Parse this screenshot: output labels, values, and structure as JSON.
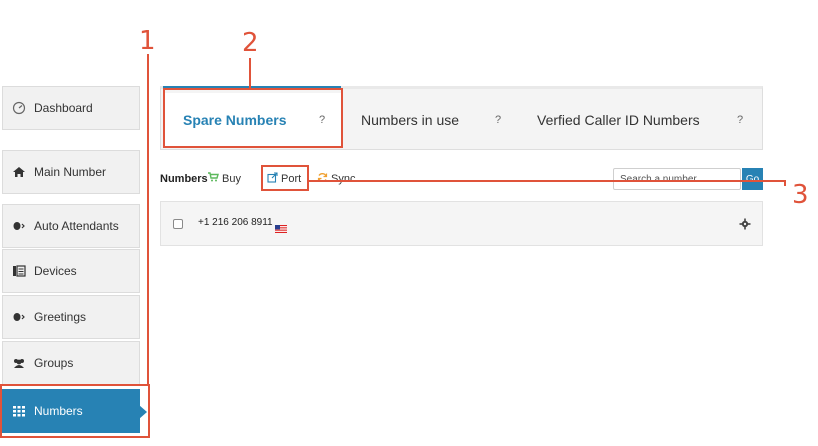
{
  "sidebar": {
    "items": [
      {
        "label": "Dashboard",
        "icon": "gauge-icon"
      },
      {
        "label": "Main Number",
        "icon": "home-icon"
      },
      {
        "label": "Auto Attendants",
        "icon": "speaker-icon"
      },
      {
        "label": "Devices",
        "icon": "devices-icon"
      },
      {
        "label": "Greetings",
        "icon": "speaker-icon"
      },
      {
        "label": "Groups",
        "icon": "users-icon"
      },
      {
        "label": "Numbers",
        "icon": "grid-icon",
        "active": true
      }
    ]
  },
  "tabs": [
    {
      "label": "Spare Numbers",
      "help": "?",
      "active": true
    },
    {
      "label": "Numbers in use",
      "help": "?"
    },
    {
      "label": "Verfied Caller ID Numbers",
      "help": "?"
    }
  ],
  "toolbar": {
    "label": "Numbers",
    "buy_label": "Buy",
    "port_label": "Port",
    "sync_label": "Sync"
  },
  "search": {
    "placeholder": "Search a number...",
    "go_label": "Go"
  },
  "numbers": [
    {
      "number": "+1 216 206 8911",
      "flag": "us-flag-icon"
    }
  ],
  "annotations": {
    "one": "1",
    "two": "2",
    "three": "3"
  },
  "colors": {
    "accent": "#2782b4",
    "annotation": "#e0533a",
    "buy_icon": "#5cb85c",
    "sync_icon": "#f0a030"
  }
}
